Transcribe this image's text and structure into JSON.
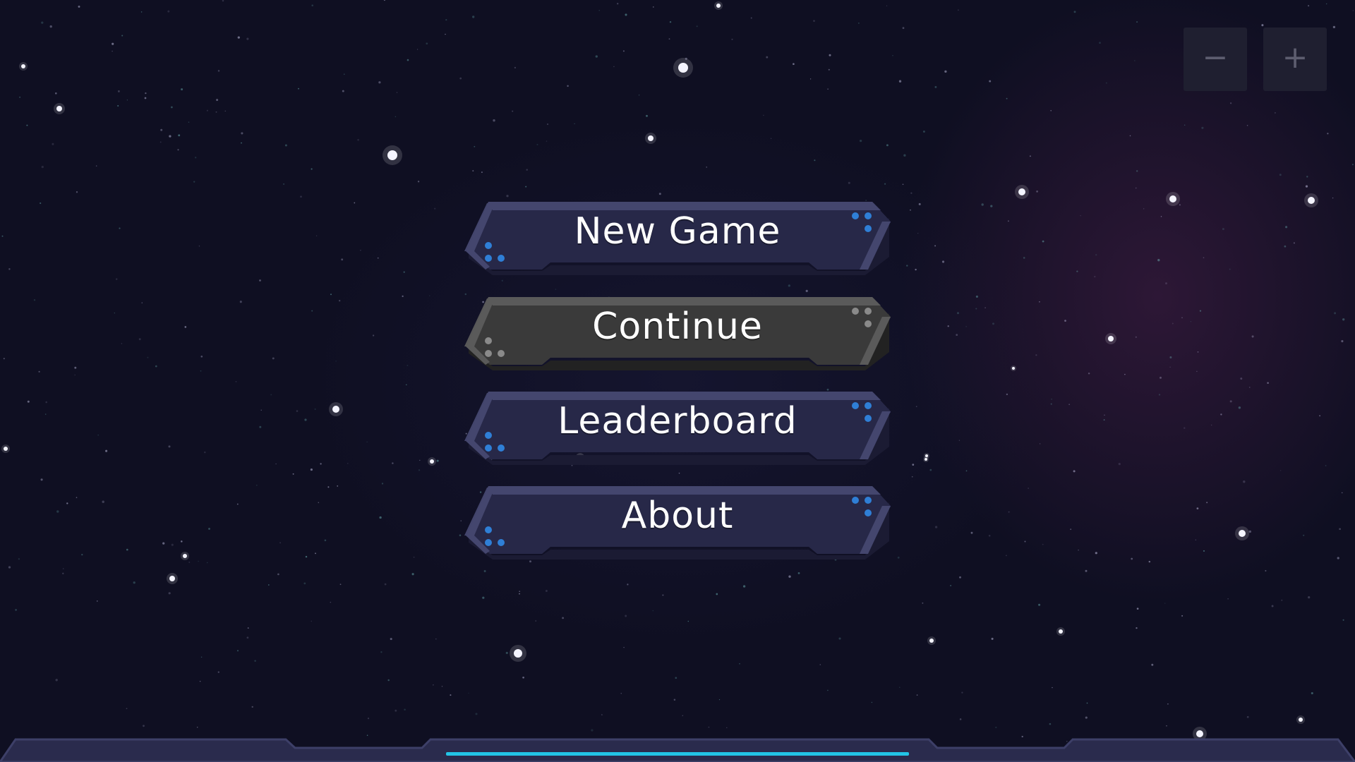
{
  "zoom": {
    "minus_label": "−",
    "plus_label": "+"
  },
  "menu": {
    "new_game": "New Game",
    "continue": "Continue",
    "leaderboard": "Leaderboard",
    "about": "About"
  },
  "colors": {
    "background": "#0f0f22",
    "button_face": "#272848",
    "button_edge": "#44466e",
    "button_shadow": "#1b1b33",
    "button_disabled_face": "#3a3a3a",
    "button_disabled_edge": "#5a5a5a",
    "dot_active": "#2f7fd6",
    "dot_disabled": "#8a8a8a",
    "progress": "#22c4e6"
  },
  "continue_enabled": false
}
